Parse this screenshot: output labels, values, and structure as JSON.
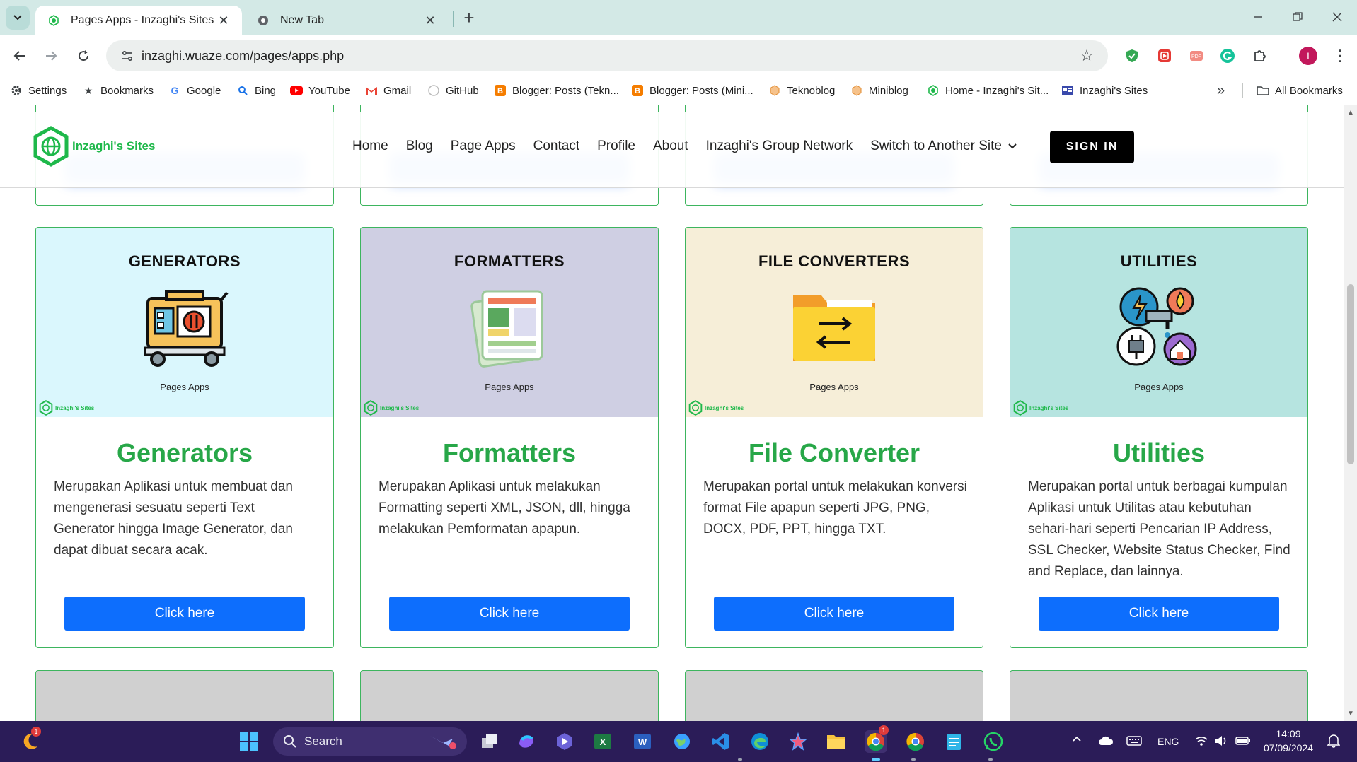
{
  "browser": {
    "tabs": [
      {
        "title": "Pages Apps - Inzaghi's Sites",
        "active": true
      },
      {
        "title": "New Tab",
        "active": false
      }
    ],
    "url": "inzaghi.wuaze.com/pages/apps.php",
    "bookmarks": [
      {
        "label": "Settings",
        "icon": "gear-icon"
      },
      {
        "label": "Bookmarks",
        "icon": "star-icon"
      },
      {
        "label": "Google",
        "icon": "google-icon"
      },
      {
        "label": "Bing",
        "icon": "search-icon"
      },
      {
        "label": "YouTube",
        "icon": "youtube-icon"
      },
      {
        "label": "Gmail",
        "icon": "gmail-icon"
      },
      {
        "label": "GitHub",
        "icon": "github-icon"
      },
      {
        "label": "Blogger: Posts (Tekn...",
        "icon": "blogger-icon"
      },
      {
        "label": "Blogger: Posts (Mini...",
        "icon": "blogger-icon"
      },
      {
        "label": "Teknoblog",
        "icon": "site-icon"
      },
      {
        "label": "Miniblog",
        "icon": "site-icon"
      },
      {
        "label": "Home - Inzaghi's Sit...",
        "icon": "inzaghi-icon"
      },
      {
        "label": "Inzaghi's Sites",
        "icon": "bookmark-page-icon"
      }
    ],
    "all_bookmarks_label": "All Bookmarks",
    "profile_initial": "I"
  },
  "site": {
    "brand_name": "Inzaghi's Sites",
    "nav": [
      "Home",
      "Blog",
      "Page Apps",
      "Contact",
      "Profile",
      "About",
      "Inzaghi's Group Network"
    ],
    "dropdown_label": "Switch to Another Site",
    "signin_label": "SIGN IN",
    "cards": [
      {
        "banner_title": "GENERATORS",
        "banner_sub": "Pages Apps",
        "watermark": "Inzaghi's Sites",
        "banner_color": "#daf7fd",
        "title": "Generators",
        "desc": "Merupakan Aplikasi untuk membuat dan mengenerasi sesuatu seperti Text Generator hingga Image Generator, dan dapat dibuat secara acak.",
        "button": "Click here",
        "icon": "generator-icon"
      },
      {
        "banner_title": "FORMATTERS",
        "banner_sub": "Pages Apps",
        "watermark": "Inzaghi's Sites",
        "banner_color": "#cfcfe3",
        "title": "Formatters",
        "desc": "Merupakan Aplikasi untuk melakukan Formatting seperti XML, JSON, dll, hingga melakukan Pemformatan apapun.",
        "button": "Click here",
        "icon": "document-layout-icon"
      },
      {
        "banner_title": "FILE CONVERTERS",
        "banner_sub": "Pages Apps",
        "watermark": "Inzaghi's Sites",
        "banner_color": "#f6eed8",
        "title": "File Converter",
        "desc": "Merupakan portal untuk melakukan konversi format File apapun seperti JPG, PNG, DOCX, PDF, PPT, hingga TXT.",
        "button": "Click here",
        "icon": "folder-convert-icon"
      },
      {
        "banner_title": "UTILITIES",
        "banner_sub": "Pages Apps",
        "watermark": "Inzaghi's Sites",
        "banner_color": "#b6e4e0",
        "title": "Utilities",
        "desc": "Merupakan portal untuk berbagai kumpulan Aplikasi untuk Utilitas atau kebutuhan sehari-hari seperti Pencarian IP Address, SSL Checker, Website Status Checker, Find and Replace, dan lainnya.",
        "button": "Click here",
        "icon": "utilities-icon"
      }
    ]
  },
  "taskbar": {
    "search_placeholder": "Search",
    "language": "ENG",
    "time": "14:09",
    "date": "07/09/2024",
    "notification_count": "1"
  },
  "colors": {
    "brand_green": "#1eb84a",
    "title_green": "#27a748",
    "button_blue": "#0d6efd",
    "tab_strip": "#d3e9e6",
    "taskbar": "#2b1c58"
  }
}
